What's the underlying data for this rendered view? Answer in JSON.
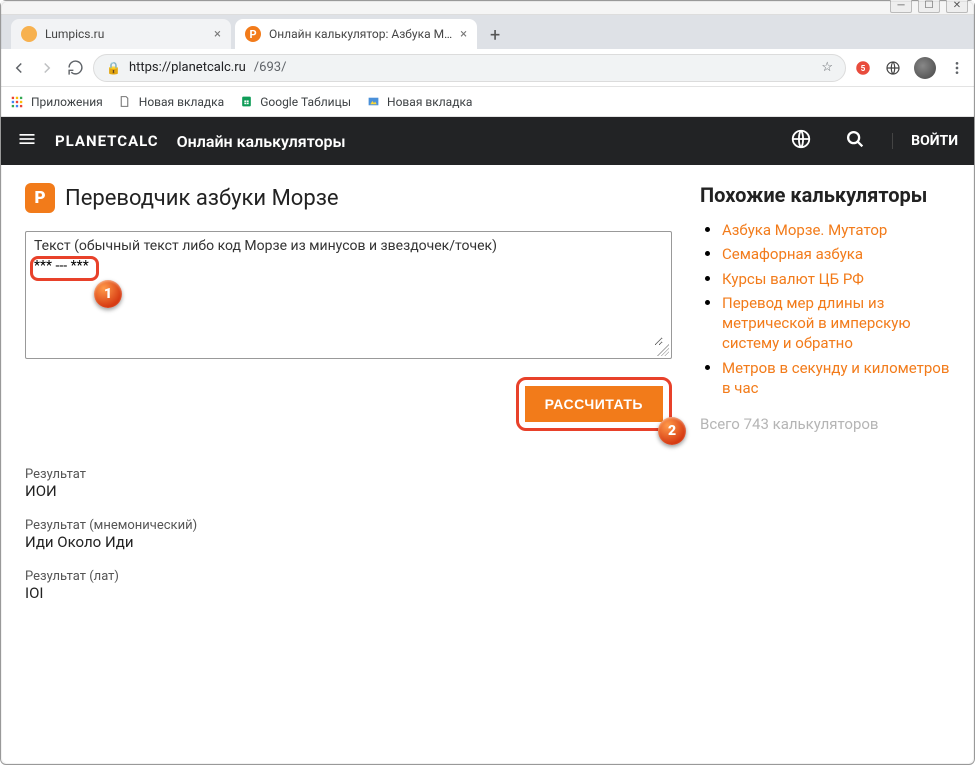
{
  "browser": {
    "tabs": [
      {
        "title": "Lumpics.ru",
        "favcolor": "#f7b14f",
        "favchar": "",
        "active": false
      },
      {
        "title": "Онлайн калькулятор: Азбука М…",
        "favcolor": "#f27b1a",
        "favchar": "P",
        "active": true
      }
    ],
    "url_host": "https://planetcalc.ru",
    "url_path": "/693/",
    "bookmarks": [
      {
        "label": "Приложения",
        "icon": "apps"
      },
      {
        "label": "Новая вкладка",
        "icon": "doc"
      },
      {
        "label": "Google Таблицы",
        "icon": "sheets"
      },
      {
        "label": "Новая вкладка",
        "icon": "image"
      }
    ]
  },
  "header": {
    "brand": "PLANETCALC",
    "subtitle": "Онлайн калькуляторы",
    "login": "ВОЙТИ"
  },
  "page": {
    "title": "Переводчик азбуки Морзе",
    "input_label": "Текст (обычный текст либо код Морзе из минусов и звездочек/точек)",
    "input_value": "*** --- ***",
    "calculate": "РАССЧИТАТЬ",
    "badge1": "1",
    "badge2": "2",
    "results": [
      {
        "label": "Результат",
        "value": "ИОИ"
      },
      {
        "label": "Результат (мнемонический)",
        "value": "Иди Около Иди"
      },
      {
        "label": "Результат (лат)",
        "value": "IOI"
      }
    ]
  },
  "sidebar": {
    "heading": "Похожие калькуляторы",
    "links": [
      "Азбука Морзе. Мутатор",
      "Семафорная азбука",
      "Курсы валют ЦБ РФ",
      "Перевод мер длины из метрической в имперскую систему и обратно",
      "Метров в секунду и километров в час"
    ],
    "total": "Всего 743 калькуляторов"
  }
}
